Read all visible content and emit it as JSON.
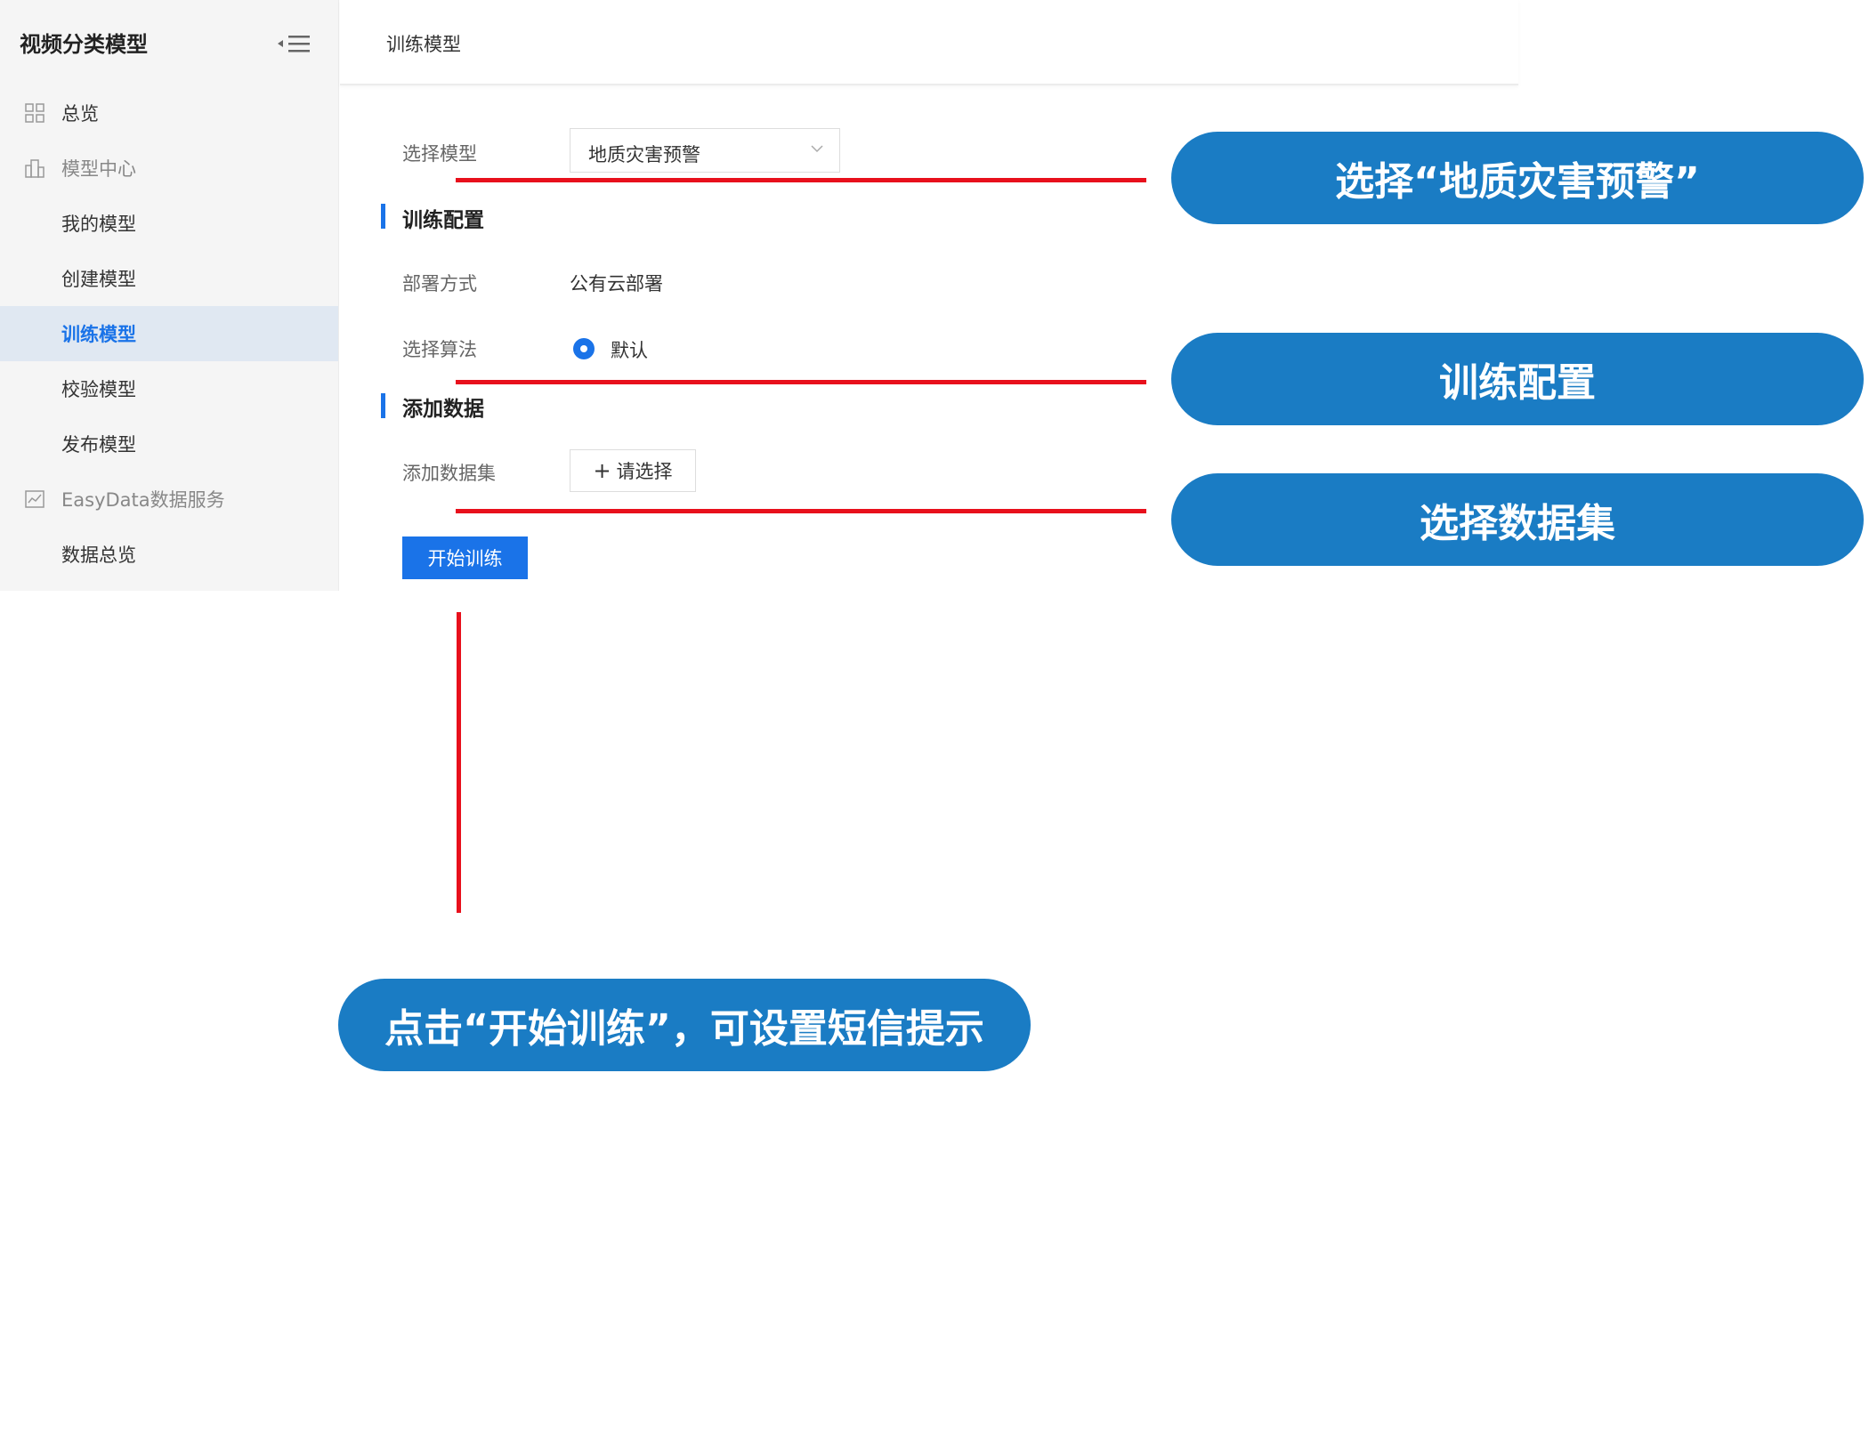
{
  "sidebar": {
    "title": "视频分类模型",
    "items": [
      {
        "label": "总览",
        "icon": "grid-icon"
      },
      {
        "label": "模型中心",
        "icon": "building-icon"
      },
      {
        "label": "我的模型"
      },
      {
        "label": "创建模型"
      },
      {
        "label": "训练模型"
      },
      {
        "label": "校验模型"
      },
      {
        "label": "发布模型"
      },
      {
        "label": "EasyData数据服务",
        "icon": "chart-icon"
      },
      {
        "label": "数据总览"
      }
    ]
  },
  "header": {
    "breadcrumb": "训练模型"
  },
  "form": {
    "model_label": "选择模型",
    "model_value": "地质灾害预警",
    "section_train": "训练配置",
    "deploy_label": "部署方式",
    "deploy_value": "公有云部署",
    "algo_label": "选择算法",
    "algo_value": "默认",
    "section_data": "添加数据",
    "dataset_label": "添加数据集",
    "dataset_button_plus": "+",
    "dataset_button": "请选择",
    "start_button": "开始训练"
  },
  "callouts": {
    "select_model": "选择“地质灾害预警”",
    "train_config": "训练配置",
    "select_dataset": "选择数据集",
    "start_training": "点击“开始训练”，可设置短信提示"
  },
  "colors": {
    "accent": "#1a73e8",
    "callout": "#1a7cc4",
    "annotation_line": "#e8101c",
    "sidebar_bg": "#f5f5f5",
    "active_bg": "#e0e8f2"
  }
}
